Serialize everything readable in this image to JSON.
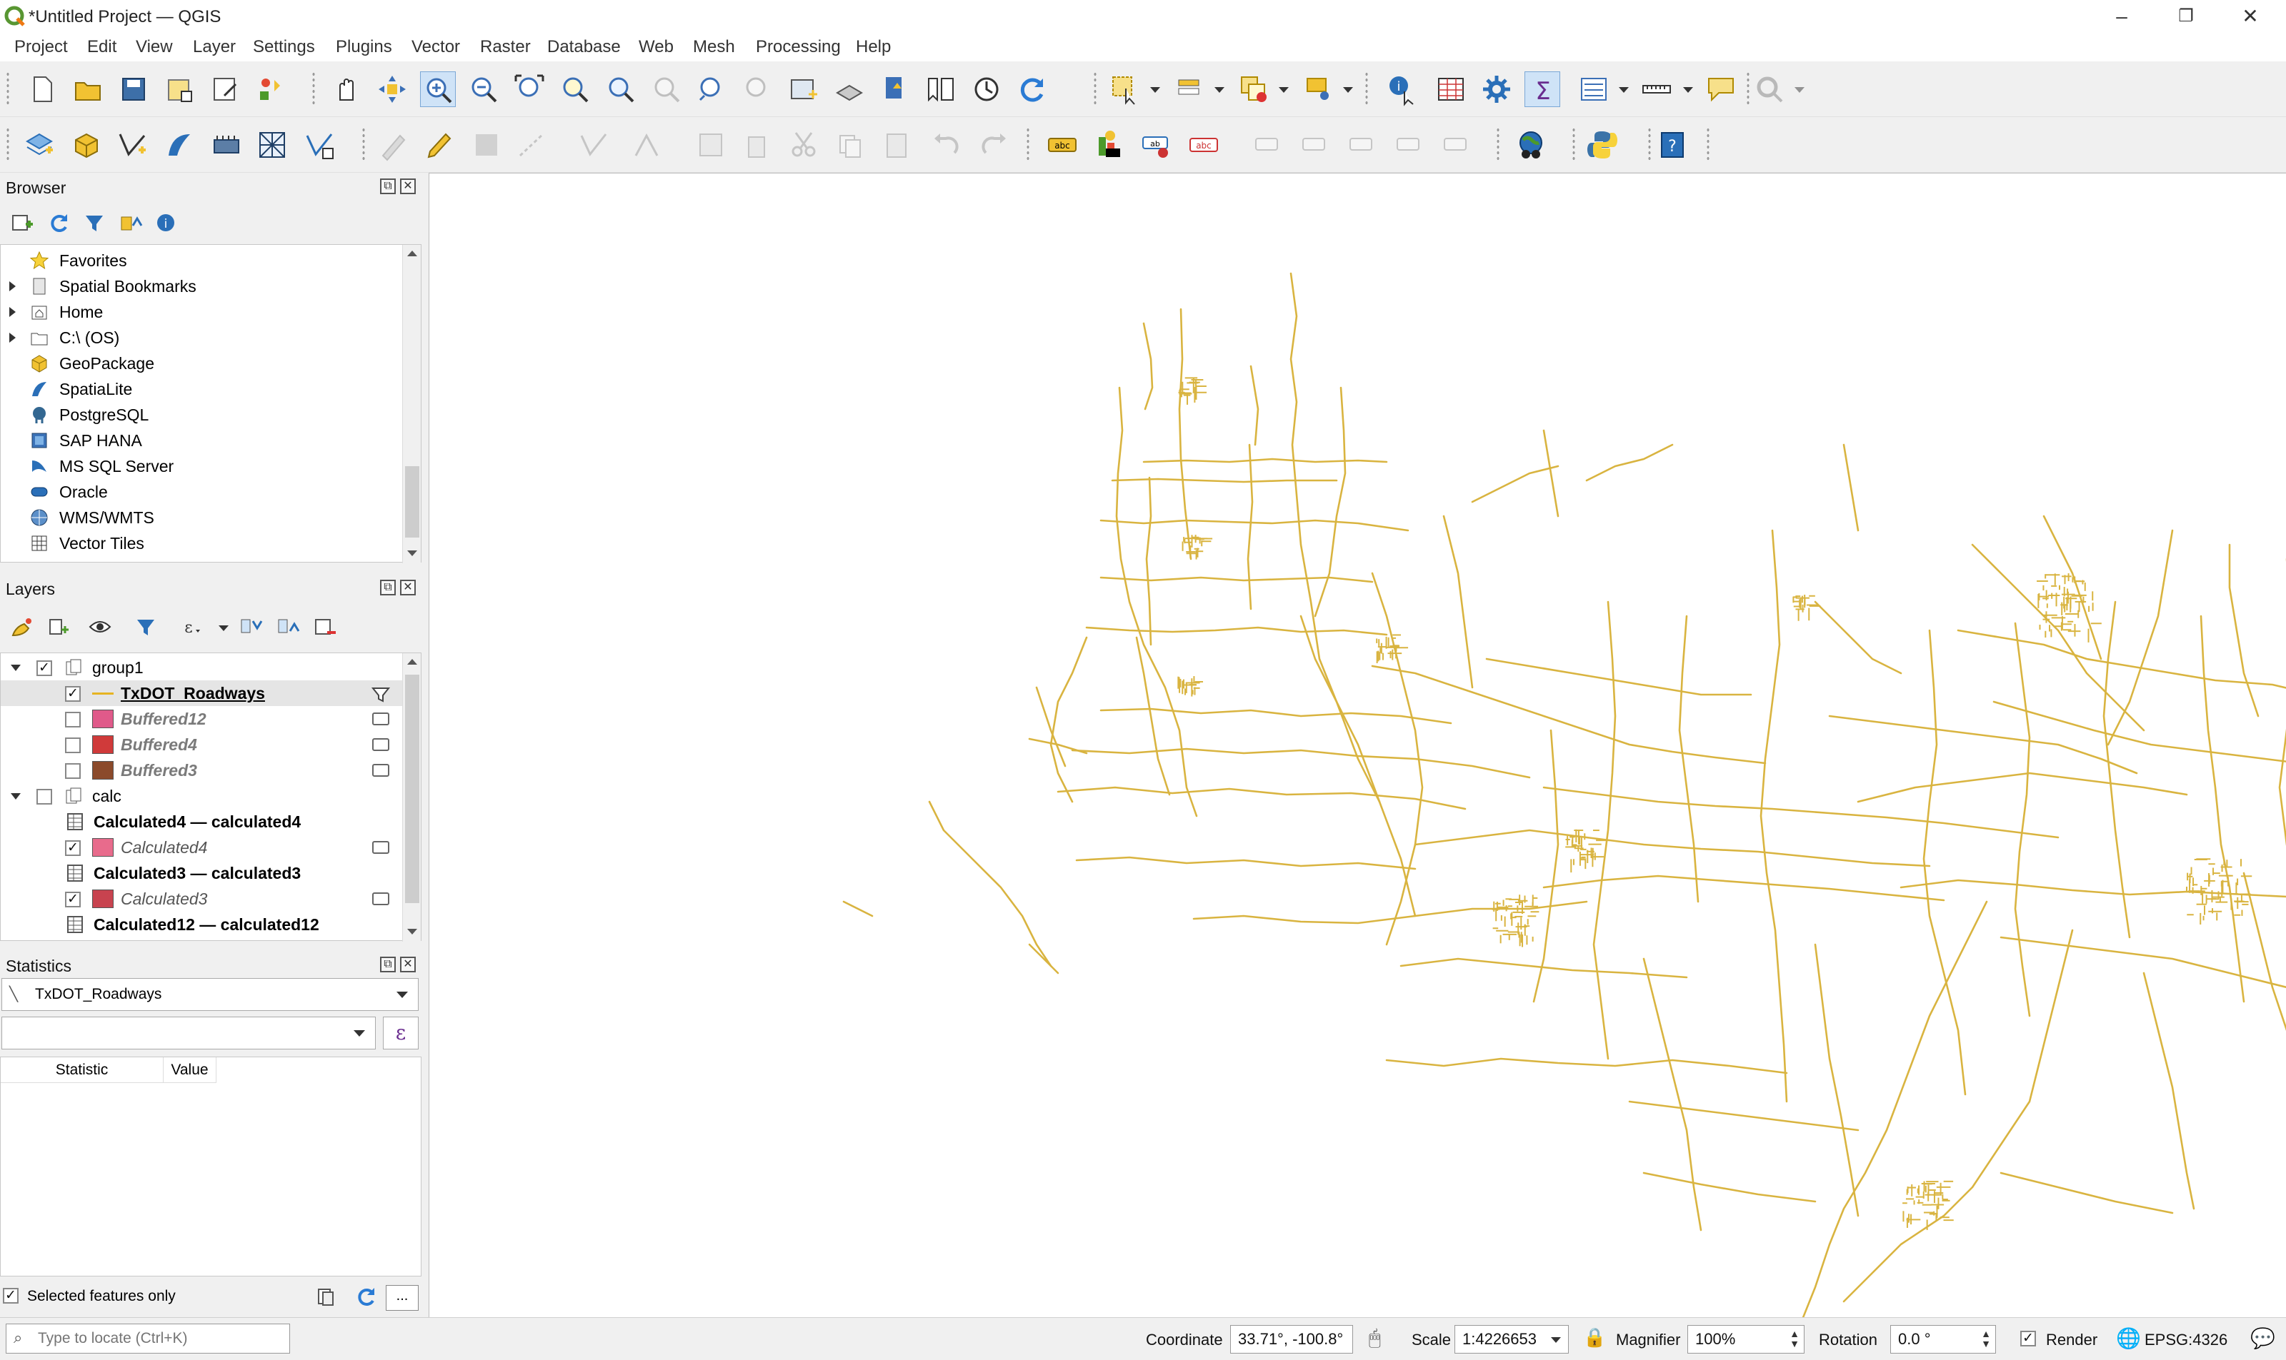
{
  "window": {
    "title": "*Untitled Project — QGIS"
  },
  "menu": [
    "Project",
    "Edit",
    "View",
    "Layer",
    "Settings",
    "Plugins",
    "Vector",
    "Raster",
    "Database",
    "Web",
    "Mesh",
    "Processing",
    "Help"
  ],
  "browser": {
    "title": "Browser",
    "items": [
      {
        "label": "Favorites",
        "icon": "star-icon",
        "expandable": false
      },
      {
        "label": "Spatial Bookmarks",
        "icon": "bookmark-icon",
        "expandable": true
      },
      {
        "label": "Home",
        "icon": "home-folder-icon",
        "expandable": true
      },
      {
        "label": "C:\\ (OS)",
        "icon": "drive-folder-icon",
        "expandable": true
      },
      {
        "label": "GeoPackage",
        "icon": "geopackage-icon",
        "expandable": false
      },
      {
        "label": "SpatiaLite",
        "icon": "spatialite-icon",
        "expandable": false
      },
      {
        "label": "PostgreSQL",
        "icon": "postgresql-icon",
        "expandable": false
      },
      {
        "label": "SAP HANA",
        "icon": "sap-hana-icon",
        "expandable": false
      },
      {
        "label": "MS SQL Server",
        "icon": "mssql-icon",
        "expandable": false
      },
      {
        "label": "Oracle",
        "icon": "oracle-icon",
        "expandable": false
      },
      {
        "label": "WMS/WMTS",
        "icon": "wms-icon",
        "expandable": false
      },
      {
        "label": "Vector Tiles",
        "icon": "vector-tiles-icon",
        "expandable": false
      }
    ]
  },
  "layers": {
    "title": "Layers",
    "items": [
      {
        "label": "group1",
        "type": "group",
        "checked": true,
        "open": true,
        "indent": 0,
        "style": "normal"
      },
      {
        "label": "TxDOT_Roadways",
        "type": "line",
        "checked": true,
        "indent": 1,
        "style": "bold-underline",
        "color": "#e6b422",
        "side": "filter"
      },
      {
        "label": "Buffered12",
        "type": "polygon",
        "checked": false,
        "indent": 1,
        "style": "bold-italic-grey",
        "color": "#e05a8a",
        "side": "memory"
      },
      {
        "label": "Buffered4",
        "type": "polygon",
        "checked": false,
        "indent": 1,
        "style": "bold-italic-grey",
        "color": "#d03a3a",
        "side": "memory"
      },
      {
        "label": "Buffered3",
        "type": "polygon",
        "checked": false,
        "indent": 1,
        "style": "bold-italic-grey",
        "color": "#8b4a2b",
        "side": "memory"
      },
      {
        "label": "calc",
        "type": "group",
        "checked": false,
        "open": true,
        "indent": 0,
        "style": "normal"
      },
      {
        "label": "Calculated4 — calculated4",
        "type": "table",
        "indent": 1,
        "style": "bold"
      },
      {
        "label": "Calculated4",
        "type": "polygon",
        "checked": true,
        "indent": 1,
        "style": "italic-grey",
        "color": "#e86b8c",
        "side": "memory"
      },
      {
        "label": "Calculated3 — calculated3",
        "type": "table",
        "indent": 1,
        "style": "bold"
      },
      {
        "label": "Calculated3",
        "type": "polygon",
        "checked": true,
        "indent": 1,
        "style": "italic-grey",
        "color": "#c8434f",
        "side": "memory"
      },
      {
        "label": "Calculated12 — calculated12",
        "type": "table",
        "indent": 1,
        "style": "bold"
      }
    ]
  },
  "statistics": {
    "title": "Statistics",
    "layer": "TxDOT_Roadways",
    "field": "",
    "columns": [
      "Statistic",
      "Value"
    ],
    "selected_only_label": "Selected features only",
    "selected_only_checked": true,
    "more_label": "..."
  },
  "locator": {
    "placeholder": "Type to locate (Ctrl+K)"
  },
  "status": {
    "coordinate_label": "Coordinate",
    "coordinate": "33.71°, -100.8°",
    "scale_label": "Scale",
    "scale": "1:4226653",
    "magnifier_label": "Magnifier",
    "magnifier": "100%",
    "rotation_label": "Rotation",
    "rotation": "0.0 °",
    "render_label": "Render",
    "render_checked": true,
    "crs": "EPSG:4326"
  },
  "colors": {
    "roads": "#d9b440",
    "accent": "#589632"
  }
}
